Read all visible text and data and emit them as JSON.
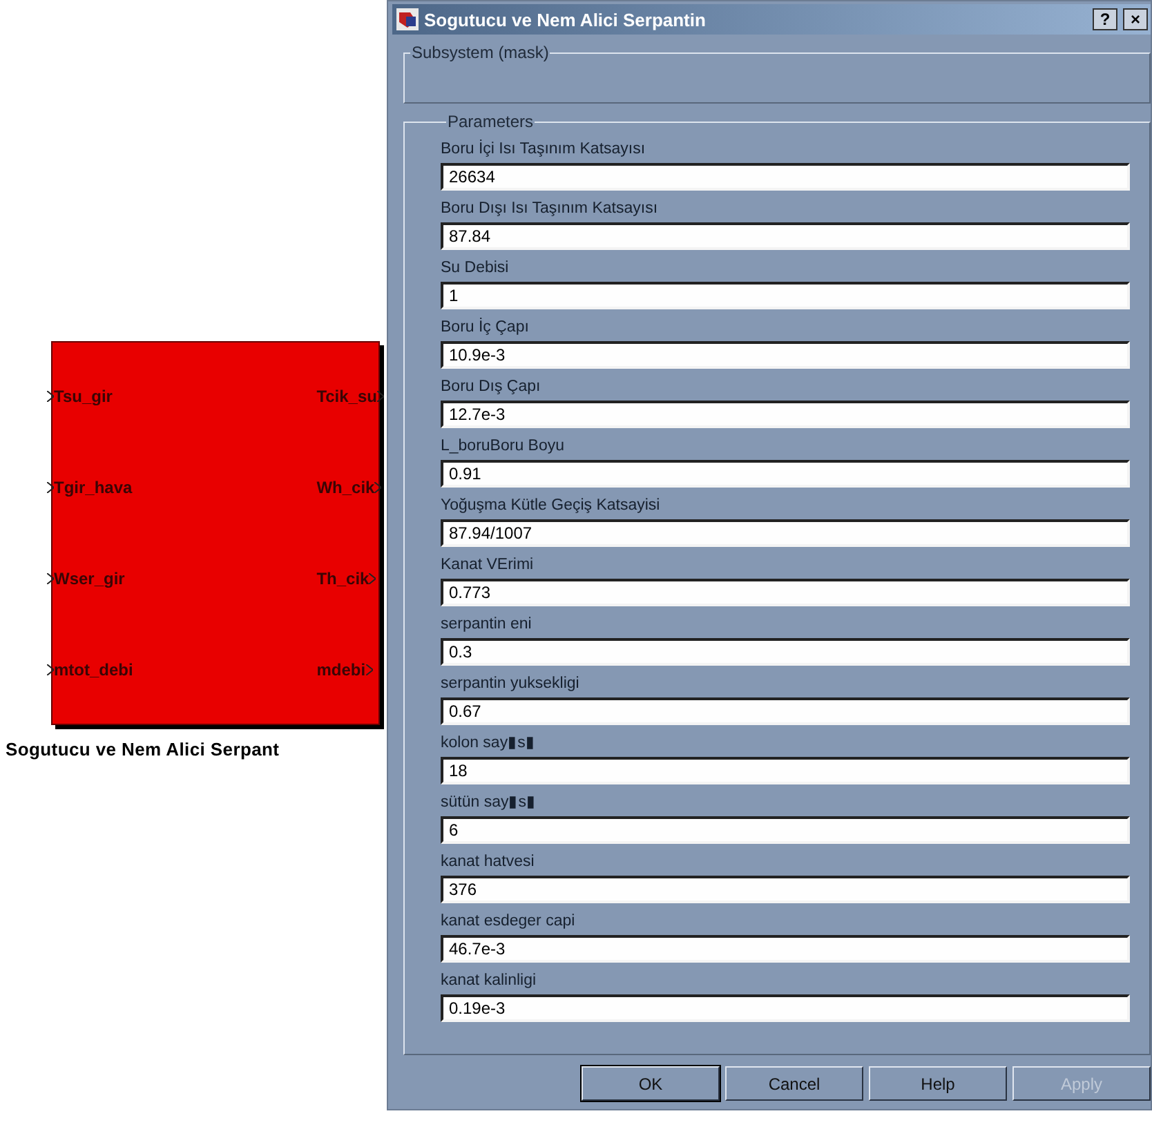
{
  "block": {
    "name": "Sogutucu ve Nem Alici Serpant",
    "inputs": [
      "Tsu_gir",
      "Tgir_hava",
      "Wser_gir",
      "mtot_debi"
    ],
    "outputs": [
      "Tcik_su",
      "Wh_cik",
      "Th_cik",
      "mdebi"
    ]
  },
  "window": {
    "title": "Sogutucu ve Nem Alici Serpantin",
    "title_buttons": [
      "?",
      "×"
    ]
  },
  "subsystem": {
    "title": "Subsystem (mask)"
  },
  "parameters": {
    "title": "Parameters",
    "items": [
      {
        "label": "Boru İçi Isı Taşınım Katsayısı",
        "value": "26634"
      },
      {
        "label": "Boru Dışı Isı Taşınım Katsayısı",
        "value": "87.84"
      },
      {
        "label": "Su Debisi",
        "value": "1"
      },
      {
        "label": "Boru İç Çapı",
        "value": "10.9e-3"
      },
      {
        "label": "Boru Dış Çapı",
        "value": "12.7e-3"
      },
      {
        "label": "L_boruBoru Boyu",
        "value": "0.91"
      },
      {
        "label": "Yoğuşma Kütle Geçiş Katsayisi",
        "value": "87.94/1007"
      },
      {
        "label": "Kanat VErimi",
        "value": "0.773"
      },
      {
        "label": "serpantin eni",
        "value": "0.3"
      },
      {
        "label": "serpantin yuksekligi",
        "value": "0.67"
      },
      {
        "label": "kolon say▮s▮",
        "value": "18"
      },
      {
        "label": "sütün say▮s▮",
        "value": "6"
      },
      {
        "label": "kanat hatvesi",
        "value": "376"
      },
      {
        "label": "kanat esdeger capi",
        "value": "46.7e-3"
      },
      {
        "label": "kanat kalinligi",
        "value": "0.19e-3"
      }
    ]
  },
  "buttons": [
    {
      "label": "OK",
      "default": true,
      "disabled": false
    },
    {
      "label": "Cancel",
      "default": false,
      "disabled": false
    },
    {
      "label": "Help",
      "default": false,
      "disabled": false
    },
    {
      "label": "Apply",
      "default": false,
      "disabled": true
    }
  ]
}
